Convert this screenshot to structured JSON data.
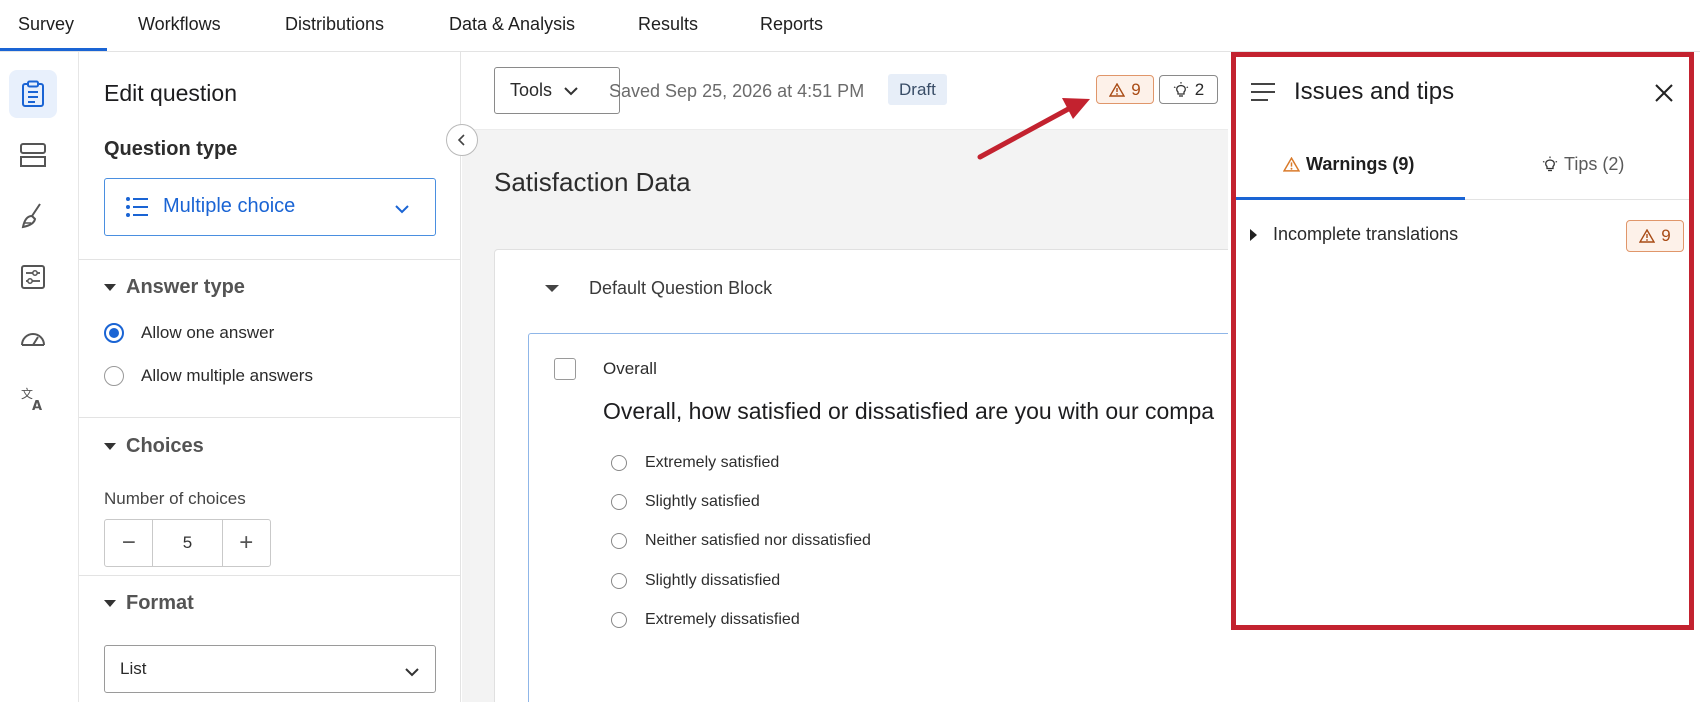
{
  "colors": {
    "accent": "#1a64d4",
    "warning": "#a84a14",
    "highlight_border": "#c3222f"
  },
  "topnav": {
    "tabs": [
      "Survey",
      "Workflows",
      "Distributions",
      "Data & Analysis",
      "Results",
      "Reports"
    ],
    "active_tab": "Survey"
  },
  "rail": {
    "icons": [
      "survey-clipboard-icon",
      "survey-flow-icon",
      "look-and-feel-brush-icon",
      "survey-options-icon",
      "tools-gauge-icon",
      "translate-icon"
    ]
  },
  "edit_panel": {
    "title": "Edit question",
    "question_type_label": "Question type",
    "question_type_value": "Multiple choice",
    "answer_type": {
      "heading": "Answer type",
      "options": [
        {
          "label": "Allow one answer",
          "checked": true
        },
        {
          "label": "Allow multiple answers",
          "checked": false
        }
      ]
    },
    "choices": {
      "heading": "Choices",
      "number_label": "Number of choices",
      "number_value": "5",
      "decrement": "−",
      "increment": "+"
    },
    "format": {
      "heading": "Format",
      "value": "List"
    }
  },
  "toolbar": {
    "tools_label": "Tools",
    "saved_text": "Saved Sep 25, 2026 at 4:51 PM",
    "status_badge": "Draft",
    "warning_count": "9",
    "tip_count": "2"
  },
  "survey": {
    "title": "Satisfaction Data",
    "block_name": "Default Question Block",
    "question": {
      "id": "Overall",
      "text": "Overall, how satisfied or dissatisfied are you with our compa",
      "choices": [
        "Extremely satisfied",
        "Slightly satisfied",
        "Neither satisfied nor dissatisfied",
        "Slightly dissatisfied",
        "Extremely dissatisfied"
      ]
    }
  },
  "issues_panel": {
    "title": "Issues and tips",
    "tabs": [
      {
        "label": "Warnings (9)",
        "active": true
      },
      {
        "label": "Tips (2)",
        "active": false
      }
    ],
    "items": [
      {
        "label": "Incomplete translations",
        "count": "9"
      }
    ]
  }
}
